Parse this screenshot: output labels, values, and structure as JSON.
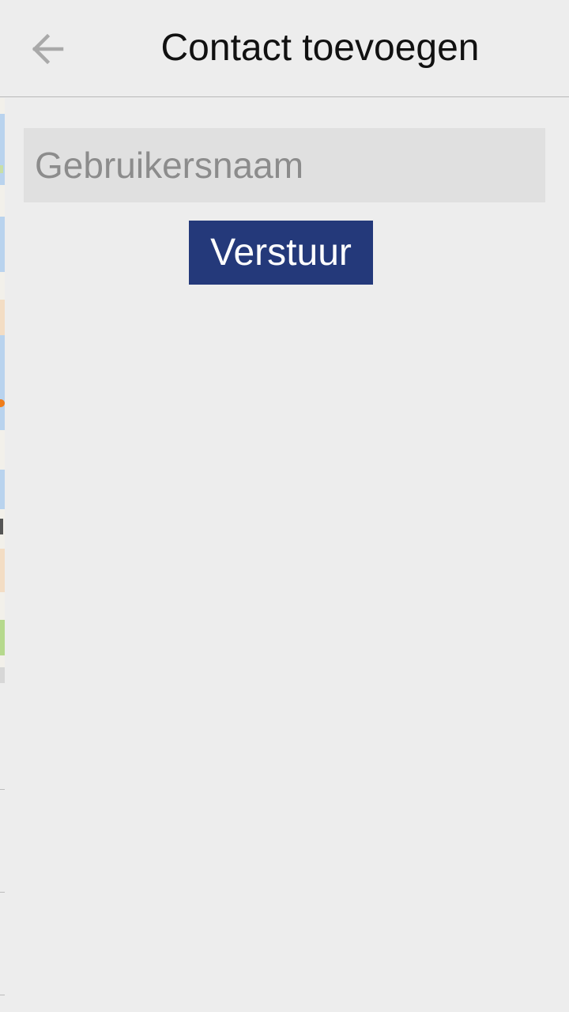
{
  "header": {
    "title": "Contact toevoegen",
    "back_icon": "arrow-left-icon"
  },
  "form": {
    "username_placeholder": "Gebruikersnaam",
    "username_value": "",
    "submit_label": "Verstuur"
  },
  "colors": {
    "background": "#ededed",
    "input_background": "#e0e0e0",
    "button_background": "#24397a",
    "button_text": "#ffffff",
    "icon": "#a9a9a9"
  }
}
